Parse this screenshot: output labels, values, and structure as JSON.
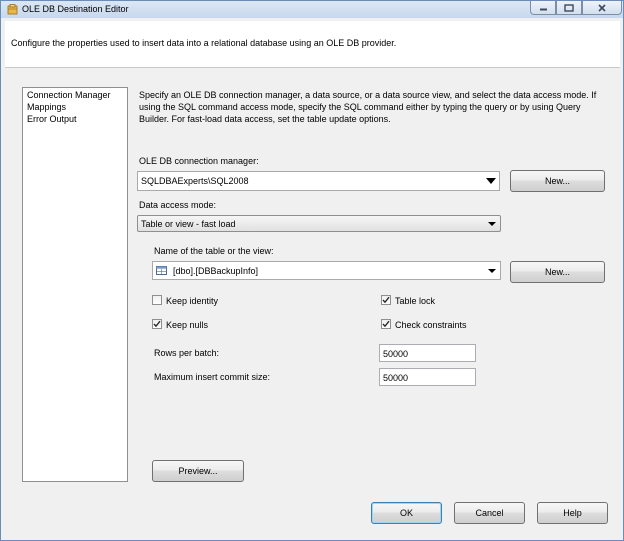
{
  "window": {
    "title": "OLE DB Destination Editor"
  },
  "header": {
    "text": "Configure the properties used to insert data into a relational database using an OLE DB provider."
  },
  "nav": {
    "items": [
      {
        "label": "Connection Manager"
      },
      {
        "label": "Mappings"
      },
      {
        "label": "Error Output"
      }
    ],
    "selected": "Connection Manager"
  },
  "main": {
    "description": "Specify an OLE DB connection manager, a data source, or a data source view, and select the data access mode. If using the SQL command access mode, specify the SQL command either by typing the query or by using Query Builder. For fast-load data access, set the table update options.",
    "connection_manager_label": "OLE DB connection manager:",
    "connection_manager_value": "SQLDBAExperts\\SQL2008",
    "new_connection_label": "New...",
    "data_access_mode_label": "Data access mode:",
    "data_access_mode_value": "Table or view - fast load",
    "table_name_label": "Name of the table or the view:",
    "table_name_value": "[dbo].[DBBackupInfo]",
    "new_table_label": "New...",
    "options": {
      "keep_identity": {
        "label": "Keep identity",
        "checked": false
      },
      "keep_nulls": {
        "label": "Keep nulls",
        "checked": true
      },
      "table_lock": {
        "label": "Table lock",
        "checked": true
      },
      "check_constraints": {
        "label": "Check constraints",
        "checked": true
      }
    },
    "rows_per_batch_label": "Rows per batch:",
    "rows_per_batch_value": "50000",
    "max_commit_label": "Maximum insert commit size:",
    "max_commit_value": "50000",
    "preview_label": "Preview..."
  },
  "footer": {
    "ok_label": "OK",
    "cancel_label": "Cancel",
    "help_label": "Help"
  },
  "icons": {
    "window_icon": "package-icon",
    "table_icon": "table-icon",
    "minimize_icon": "minimize-icon",
    "maximize_icon": "maximize-icon",
    "close_icon": "close-icon",
    "checkmark_icon": "checkmark-icon"
  },
  "colors": {
    "titlebar": "#c7d8ee",
    "close_button": "#c7d8ee",
    "default_button_border": "#3c7fb1"
  }
}
